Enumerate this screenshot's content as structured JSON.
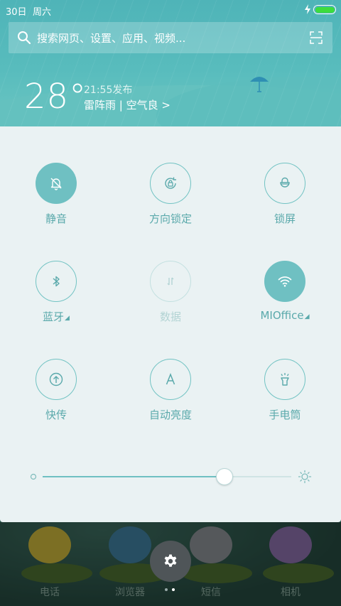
{
  "status_bar": {
    "date": "30日",
    "weekday": "周六",
    "battery_color": "#3ddc3d"
  },
  "search": {
    "placeholder": "搜索网页、设置、应用、视频..."
  },
  "weather": {
    "temperature": "28°",
    "time": "21:55发布",
    "description": "雷阵雨 | 空气良 >"
  },
  "toggles": [
    {
      "label": "静音",
      "icon": "bell-off-icon",
      "state": "on"
    },
    {
      "label": "方向锁定",
      "icon": "rotation-lock-icon",
      "state": "off-enabled"
    },
    {
      "label": "锁屏",
      "icon": "lock-icon",
      "state": "off-enabled"
    },
    {
      "label": "蓝牙",
      "icon": "bluetooth-icon",
      "state": "off-enabled",
      "has_dropdown": true
    },
    {
      "label": "数据",
      "icon": "data-icon",
      "state": "disabled"
    },
    {
      "label": "MIOffice",
      "icon": "wifi-icon",
      "state": "on",
      "has_dropdown": true
    },
    {
      "label": "快传",
      "icon": "upload-icon",
      "state": "off-enabled"
    },
    {
      "label": "自动亮度",
      "icon": "auto-brightness-icon",
      "state": "off-enabled"
    },
    {
      "label": "手电筒",
      "icon": "flashlight-icon",
      "state": "off-enabled"
    }
  ],
  "brightness": {
    "value": 0.73
  },
  "dock": {
    "apps": [
      "电话",
      "浏览器",
      "短信",
      "相机"
    ]
  },
  "colors": {
    "accent": "#6fc0c2",
    "panel_bg": "#eaf2f3",
    "header_bg": "#58bcbd"
  }
}
